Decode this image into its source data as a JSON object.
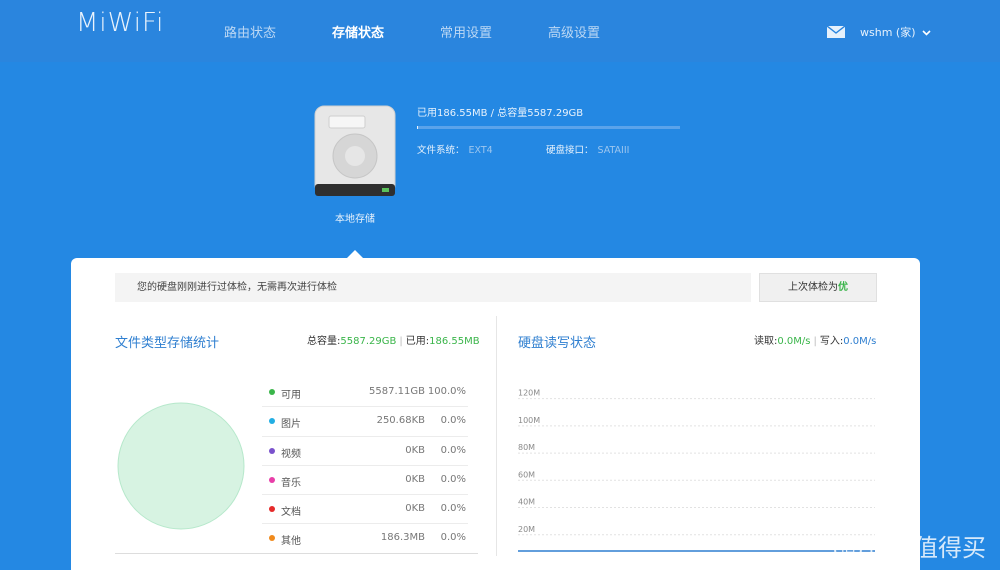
{
  "header": {
    "logo": "MiWiFi",
    "nav": [
      {
        "label": "路由状态"
      },
      {
        "label": "存储状态",
        "active": true
      },
      {
        "label": "常用设置"
      },
      {
        "label": "高级设置"
      }
    ],
    "mail_icon": "mail-icon",
    "user": "wshm (家)"
  },
  "disk": {
    "icon": "hard-disk-icon",
    "caption": "本地存储",
    "usage": "已用186.55MB / 总容量5587.29GB",
    "used_fraction": 3.26e-05,
    "fs_label": "文件系统：",
    "fs_value": "EXT4",
    "iface_label": "硬盘接口：",
    "iface_value": "SATAIII"
  },
  "notice": {
    "text": "您的硬盘刚刚进行过体检，无需再次进行体检",
    "button_prefix": "上次体检为",
    "button_result": "优"
  },
  "file_stats": {
    "title": "文件类型存储统计",
    "total_label": "总容量:",
    "total_value": "5587.29GB",
    "used_label": "已用:",
    "used_value": "186.55MB",
    "rows": [
      {
        "name": "可用",
        "size": "5587.11GB",
        "pct": "100.0%",
        "color": "#3ab54a"
      },
      {
        "name": "图片",
        "size": "250.68KB",
        "pct": "0.0%",
        "color": "#22aee3"
      },
      {
        "name": "视频",
        "size": "0KB",
        "pct": "0.0%",
        "color": "#7a52cc"
      },
      {
        "name": "音乐",
        "size": "0KB",
        "pct": "0.0%",
        "color": "#e83ea8"
      },
      {
        "name": "文档",
        "size": "0KB",
        "pct": "0.0%",
        "color": "#e52a2a"
      },
      {
        "name": "其他",
        "size": "186.3MB",
        "pct": "0.0%",
        "color": "#f08a1c"
      }
    ],
    "pie_color": "#d7f3e2",
    "pie_edge": "#b6e8cb"
  },
  "rw_status": {
    "title": "硬盘读写状态",
    "read_label": "读取:",
    "read_value": "0.0M/s",
    "write_label": "写入:",
    "write_value": "0.0M/s"
  },
  "chart_data": {
    "type": "line",
    "title": "硬盘读写状态",
    "yticks": [
      "120M",
      "100M",
      "80M",
      "60M",
      "40M",
      "20M"
    ],
    "ylim": [
      0,
      130
    ],
    "tick_values": [
      120,
      100,
      80,
      60,
      40,
      20
    ],
    "series": [
      {
        "values": [
          0,
          0,
          0,
          0,
          0,
          0,
          0,
          0,
          0,
          0
        ],
        "color": "#2f7fd0"
      }
    ],
    "grid": true
  },
  "watermark": {
    "badge": "值",
    "text": "什么值得买"
  }
}
